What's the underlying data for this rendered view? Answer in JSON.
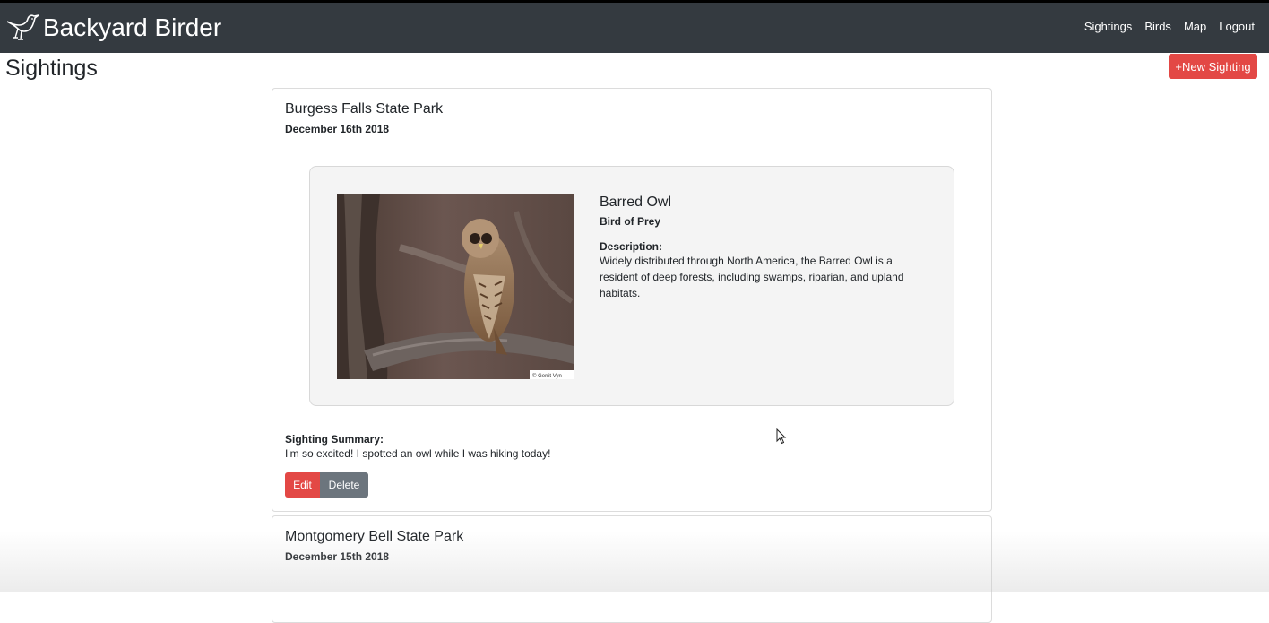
{
  "app": {
    "brand": "Backyard Birder",
    "brand_icon": "bird-logo-icon"
  },
  "nav": {
    "links": [
      "Sightings",
      "Birds",
      "Map",
      "Logout"
    ]
  },
  "page": {
    "title": "Sightings",
    "new_button": "+New Sighting"
  },
  "sightings": [
    {
      "location": "Burgess Falls State Park",
      "date": "December 16th 2018",
      "bird": {
        "name": "Barred Owl",
        "type": "Bird of Prey",
        "description_label": "Description:",
        "description": "Widely distributed through North America, the Barred Owl is a resident of deep forests, including swamps, riparian, and upland habitats.",
        "photo_credit": "© Gerrit Vyn"
      },
      "summary_label": "Sighting Summary:",
      "summary": "I'm so excited! I spotted an owl while I was hiking today!",
      "edit_label": "Edit",
      "delete_label": "Delete"
    },
    {
      "location": "Montgomery Bell State Park",
      "date": "December 15th 2018"
    }
  ],
  "colors": {
    "navbar": "#343a40",
    "primary_button": "#e34845",
    "secondary_button": "#6c757d",
    "panel": "#f4f4f4"
  }
}
